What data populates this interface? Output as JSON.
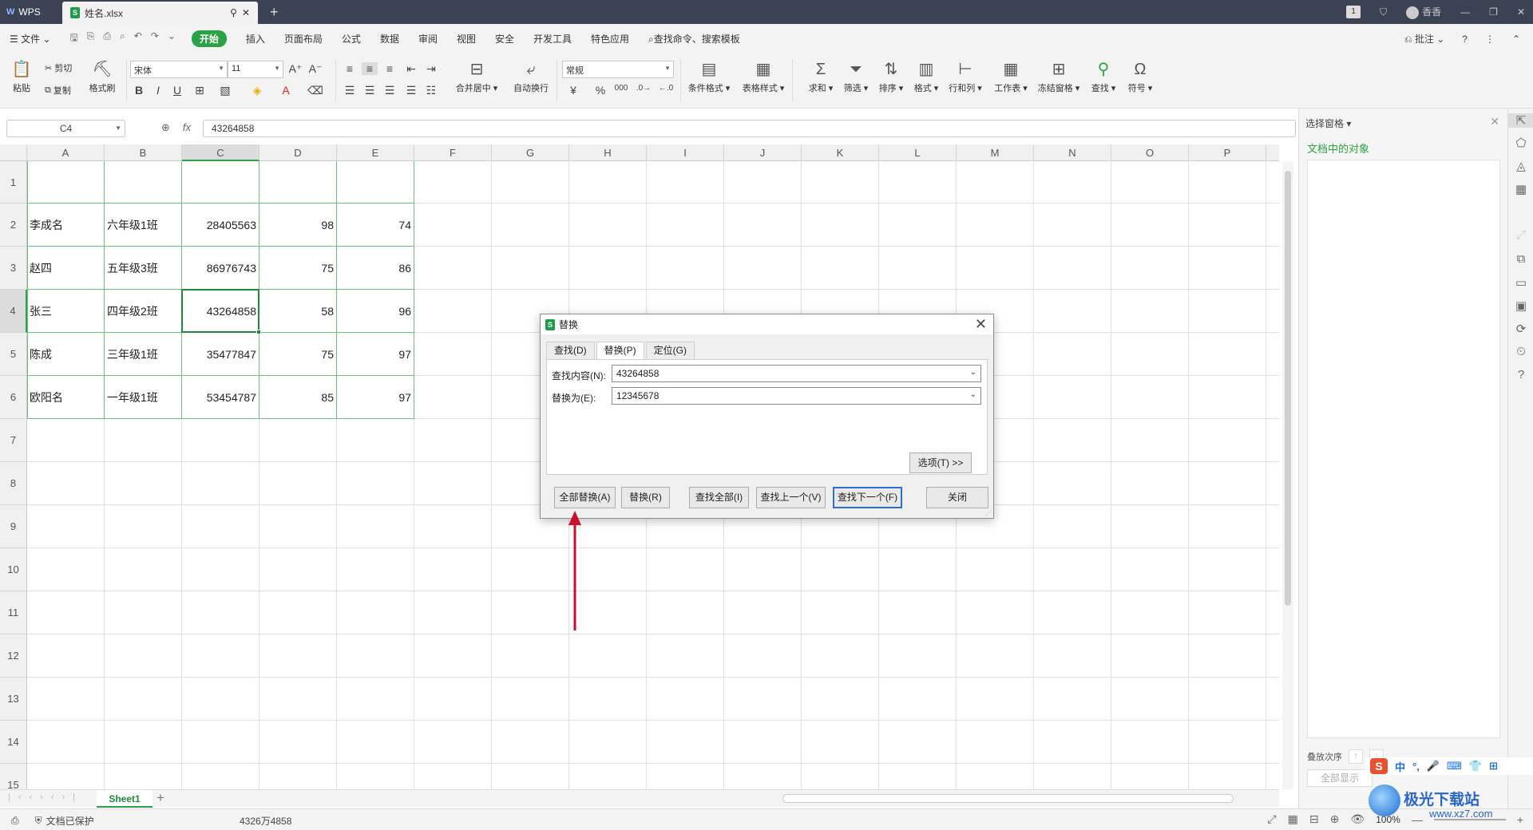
{
  "titlebar": {
    "app_name": "WPS",
    "file_tab": "姓名.xlsx",
    "user_name": "香香",
    "page_indicator": "1"
  },
  "menubar": {
    "file_label": "文件",
    "items": [
      "开始",
      "插入",
      "页面布局",
      "公式",
      "数据",
      "审阅",
      "视图",
      "安全",
      "开发工具",
      "特色应用"
    ],
    "search_label": "查找命令、搜索模板",
    "comment_label": "批注"
  },
  "ribbon": {
    "paste": "粘贴",
    "cut": "剪切",
    "copy": "复制",
    "format_painter": "格式刷",
    "font_name": "宋体",
    "font_size": "11",
    "merge_center": "合并居中",
    "wrap_text": "自动换行",
    "number_format": "常规",
    "conditional_format": "条件格式",
    "table_style": "表格样式",
    "sum": "求和",
    "filter": "筛选",
    "sort": "排序",
    "format": "格式",
    "rows_cols": "行和列",
    "worksheet": "工作表",
    "freeze": "冻结窗格",
    "find": "查找",
    "symbol": "符号"
  },
  "formula_bar": {
    "name_box": "C4",
    "fx": "fx",
    "value": "43264858"
  },
  "grid": {
    "columns": [
      "A",
      "B",
      "C",
      "D",
      "E",
      "F",
      "G",
      "H",
      "I",
      "J",
      "K",
      "L",
      "M",
      "N",
      "O",
      "P"
    ],
    "rows": [
      "1",
      "2",
      "3",
      "4",
      "5",
      "6",
      "7",
      "8",
      "9",
      "10",
      "11",
      "12",
      "13",
      "14",
      "15"
    ],
    "data": [
      [
        "李成名",
        "六年级1班",
        "28405563",
        "98",
        "74"
      ],
      [
        "赵四",
        "五年级3班",
        "86976743",
        "75",
        "86"
      ],
      [
        "张三",
        "四年级2班",
        "43264858",
        "58",
        "96"
      ],
      [
        "陈成",
        "三年级1班",
        "35477847",
        "75",
        "97"
      ],
      [
        "欧阳名",
        "一年级1班",
        "53454787",
        "85",
        "97"
      ]
    ],
    "active_cell": "C4"
  },
  "sheet_tabs": {
    "active": "Sheet1"
  },
  "statusbar": {
    "protect_text": "文档已保护",
    "sum_text": "4326万4858",
    "zoom": "100%"
  },
  "right_pane": {
    "title": "选择窗格",
    "subtitle": "文档中的对象",
    "order_label": "叠放次序",
    "show_all": "全部显示"
  },
  "dialog": {
    "title": "替换",
    "tabs": [
      "查找(D)",
      "替换(P)",
      "定位(G)"
    ],
    "active_tab": "替换(P)",
    "find_label": "查找内容(N):",
    "find_value": "43264858",
    "replace_label": "替换为(E):",
    "replace_value": "12345678",
    "options_button": "选项(T) >>",
    "buttons": {
      "replace_all": "全部替换(A)",
      "replace": "替换(R)",
      "find_all": "查找全部(I)",
      "find_prev": "查找上一个(V)",
      "find_next": "查找下一个(F)",
      "close": "关闭"
    }
  },
  "watermark": {
    "ime_chars": [
      "中",
      "°,",
      "🎤",
      "⌨",
      "👕",
      "⊞"
    ],
    "brand": "极光下载站",
    "url": "www.xz7.com"
  },
  "colors": {
    "accent_green": "#2ba245",
    "arrow_red": "#c8102e",
    "titlebar_bg": "#3b4253"
  }
}
